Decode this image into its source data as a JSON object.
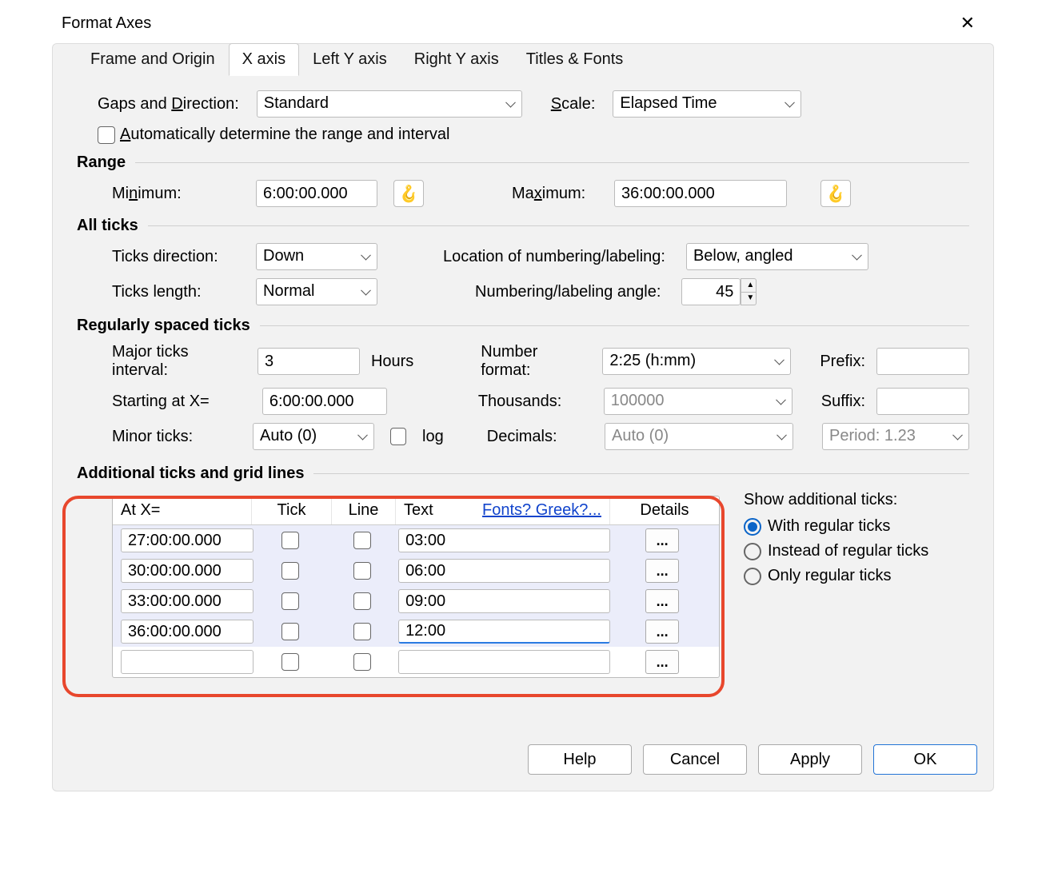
{
  "title": "Format Axes",
  "tabs": [
    "Frame and Origin",
    "X axis",
    "Left Y axis",
    "Right Y axis",
    "Titles & Fonts"
  ],
  "active_tab": 1,
  "labels": {
    "gaps": "Gaps and Direction:",
    "scale": "Scale:",
    "auto_range": "Automatically determine the range and interval",
    "range": "Range",
    "min": "Minimum:",
    "max": "Maximum:",
    "all_ticks": "All ticks",
    "ticks_dir": "Ticks direction:",
    "loc_num": "Location of numbering/labeling:",
    "ticks_len": "Ticks length:",
    "num_angle": "Numbering/labeling angle:",
    "reg_ticks": "Regularly spaced ticks",
    "major_int": "Major ticks interval:",
    "major_unit": "Hours",
    "num_fmt": "Number format:",
    "prefix": "Prefix:",
    "start_x": "Starting at X=",
    "thousands": "Thousands:",
    "suffix": "Suffix:",
    "minor": "Minor ticks:",
    "log": "log",
    "decimals": "Decimals:",
    "period": "Period: 1.23",
    "add_ticks_title": "Additional ticks and grid lines",
    "show_add": "Show additional ticks:",
    "radio1": "With regular ticks",
    "radio2": "Instead of regular ticks",
    "radio3": "Only regular ticks",
    "fonts_link": "Fonts? Greek?..."
  },
  "values": {
    "gaps": "Standard",
    "scale": "Elapsed Time",
    "min": "6:00:00.000",
    "max": "36:00:00.000",
    "ticks_dir": "Down",
    "loc_num": "Below, angled",
    "ticks_len": "Normal",
    "angle": "45",
    "major_int": "3",
    "num_fmt": "2:25 (h:mm)",
    "prefix": "",
    "start_x": "6:00:00.000",
    "thousands": "100000",
    "suffix": "",
    "minor": "Auto (0)",
    "decimals": "Auto (0)"
  },
  "col_headers": {
    "atx": "At X=",
    "tick": "Tick",
    "line": "Line",
    "text": "Text",
    "details": "Details"
  },
  "tick_rows": [
    {
      "atx": "27:00:00.000",
      "text": "03:00"
    },
    {
      "atx": "30:00:00.000",
      "text": "06:00"
    },
    {
      "atx": "33:00:00.000",
      "text": "09:00"
    },
    {
      "atx": "36:00:00.000",
      "text": "12:00"
    },
    {
      "atx": "",
      "text": ""
    }
  ],
  "buttons": {
    "help": "Help",
    "cancel": "Cancel",
    "apply": "Apply",
    "ok": "OK"
  }
}
